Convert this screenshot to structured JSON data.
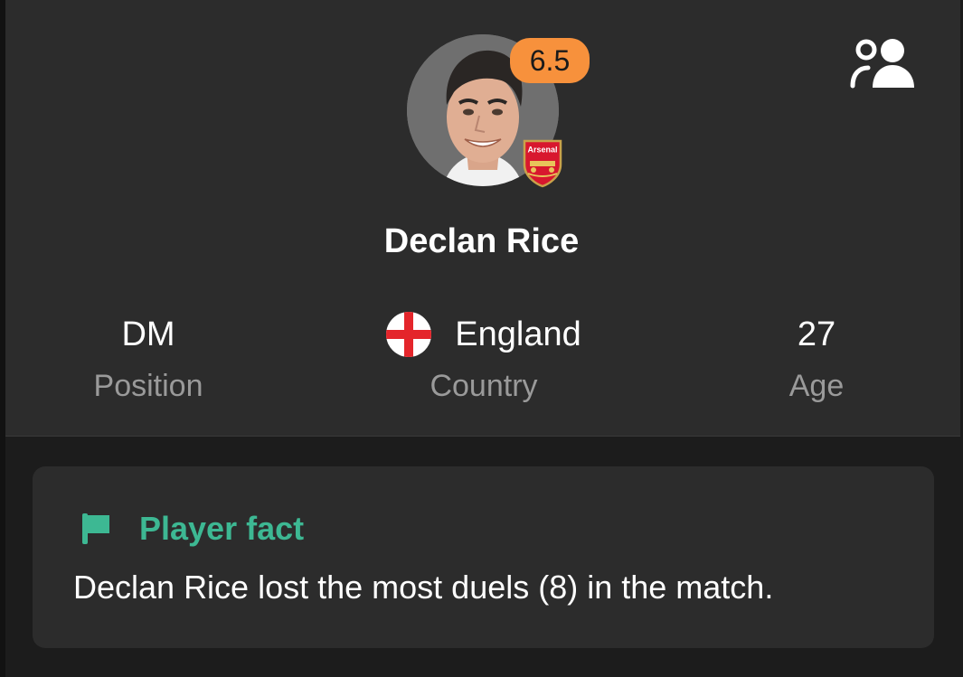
{
  "player": {
    "name": "Declan Rice",
    "rating": "6.5",
    "club_badge": "arsenal-crest",
    "club_badge_text": "Arsenal"
  },
  "stats": [
    {
      "value": "DM",
      "label": "Position"
    },
    {
      "value": "England",
      "label": "Country",
      "flag": "england-flag-icon"
    },
    {
      "value": "27",
      "label": "Age"
    }
  ],
  "fact": {
    "icon": "flag-icon",
    "title": "Player fact",
    "text": "Declan Rice lost the most duels (8) in the match."
  },
  "icons": {
    "friends": "people-icon"
  },
  "colors": {
    "background": "#1c1c1c",
    "card": "#2c2c2c",
    "rating_badge": "#f7913c",
    "accent_green": "#3db893",
    "label_gray": "#9a9a9a"
  }
}
